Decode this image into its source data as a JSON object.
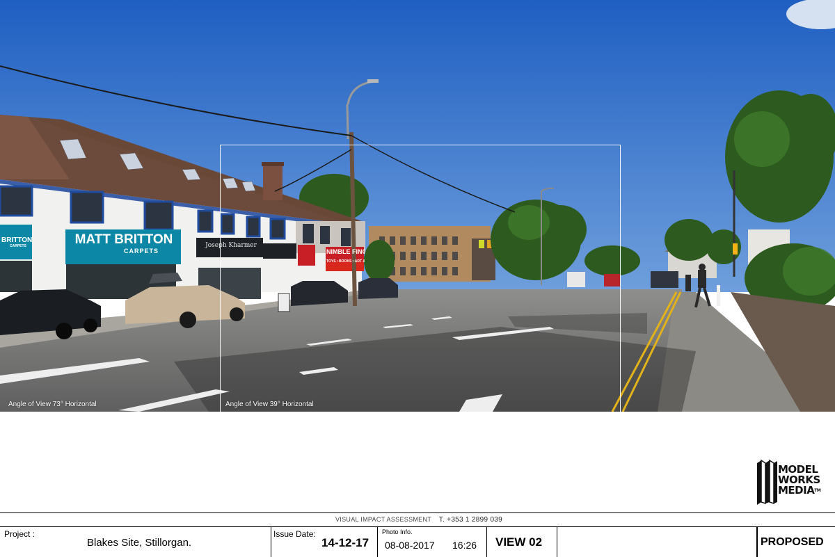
{
  "photo": {
    "labels": {
      "wide": "Angle of View 73° Horizontal",
      "narrow": "Angle of View 39° Horizontal"
    },
    "shop_signs": {
      "carpets": "MATT BRITTON",
      "carpets_sub": "CARPETS",
      "left_partial": "BRITTON",
      "left_partial_sub": "CARPETS",
      "joseph": "Joseph Kharmer",
      "nimble": "NIMBLE FINGERS",
      "nimble_sub": "TOYS • BOOKS • ART & CRAFT"
    }
  },
  "logo": {
    "lines": [
      "MODEL",
      "WORKS",
      "MEDIA"
    ],
    "tm": "TM"
  },
  "caption": {
    "title": "VISUAL IMPACT ASSESSMENT",
    "phone": "T. +353 1 2899 039"
  },
  "titleblock": {
    "project_label": "Project :",
    "project_value": "Blakes Site, Stillorgan.",
    "issue_label": "Issue Date:",
    "issue_value": "14-12-17",
    "photo_label": "Photo Info.",
    "photo_date": "08-08-2017",
    "photo_time": "16:26",
    "view": "VIEW 02",
    "status": "PROPOSED"
  }
}
